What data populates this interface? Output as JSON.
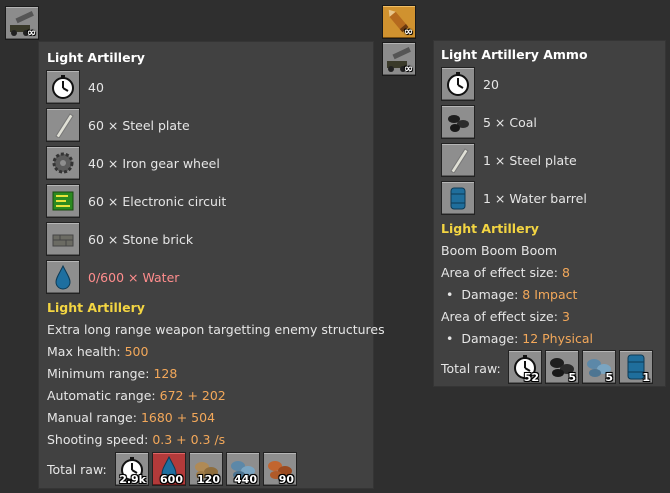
{
  "top_slots": {
    "artillery_badge": "∞",
    "ammo_badge": "∞",
    "ammo_sub_badge": "∞"
  },
  "left": {
    "title": "Light Artillery",
    "ingredients": [
      {
        "text": "40",
        "icon": "time-icon"
      },
      {
        "text": "60 × Steel plate",
        "icon": "steel-plate-icon"
      },
      {
        "text": "40 × Iron gear wheel",
        "icon": "iron-gear-wheel-icon"
      },
      {
        "text": "60 × Electronic circuit",
        "icon": "electronic-circuit-icon"
      },
      {
        "text": "60 × Stone brick",
        "icon": "stone-brick-icon"
      },
      {
        "text": "0/600 × Water",
        "icon": "water-icon"
      }
    ],
    "section_title": "Light Artillery",
    "description": "Extra long range weapon targetting enemy structures",
    "stats": [
      {
        "label": "Max health: ",
        "value": "500"
      },
      {
        "label": "Minimum range: ",
        "value": "128"
      },
      {
        "label": "Automatic range: ",
        "value": "672 + 202"
      },
      {
        "label": "Manual range: ",
        "value": "1680 + 504"
      },
      {
        "label": "Shooting speed: ",
        "value": "0.3 + 0.3 /s"
      }
    ],
    "total_raw_label": "Total raw:",
    "raw": [
      {
        "count": "2.9k",
        "icon": "time-icon"
      },
      {
        "count": "600",
        "icon": "water-icon"
      },
      {
        "count": "120",
        "icon": "stone-icon"
      },
      {
        "count": "440",
        "icon": "iron-ore-icon"
      },
      {
        "count": "90",
        "icon": "copper-ore-icon"
      }
    ]
  },
  "right": {
    "title": "Light Artillery Ammo",
    "ingredients": [
      {
        "text": "20",
        "icon": "time-icon"
      },
      {
        "text": "5 × Coal",
        "icon": "coal-icon"
      },
      {
        "text": "1 × Steel plate",
        "icon": "steel-plate-icon"
      },
      {
        "text": "1 × Water barrel",
        "icon": "water-barrel-icon"
      }
    ],
    "section_title": "Light Artillery",
    "subtitle": "Boom Boom Boom",
    "effects": [
      {
        "label": "Area of effect size: ",
        "value": "8"
      },
      {
        "label": "Damage: ",
        "value": "8 Impact",
        "bullet": "•"
      },
      {
        "label": "Area of effect size: ",
        "value": "3"
      },
      {
        "label": "Damage: ",
        "value": "12 Physical",
        "bullet": "•"
      }
    ],
    "total_raw_label": "Total raw:",
    "raw": [
      {
        "count": "52",
        "icon": "time-icon"
      },
      {
        "count": "5",
        "icon": "coal-icon"
      },
      {
        "count": "5",
        "icon": "iron-ore-icon"
      },
      {
        "count": "1",
        "icon": "water-barrel-icon"
      }
    ]
  }
}
